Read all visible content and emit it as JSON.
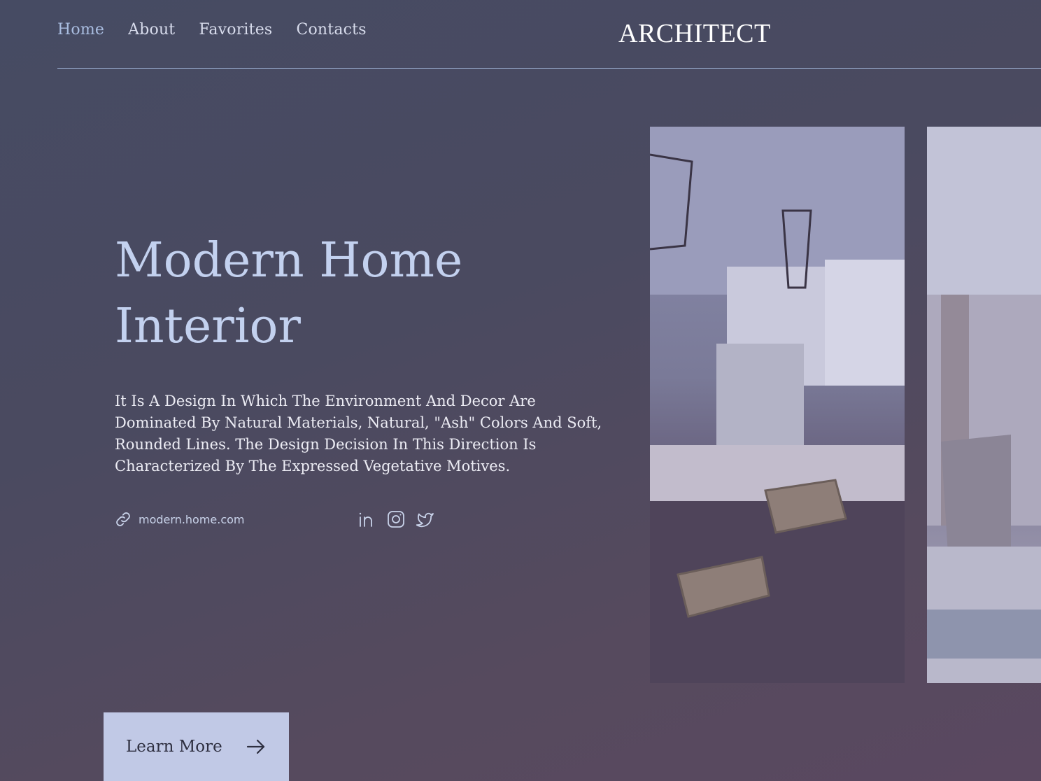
{
  "nav": {
    "items": [
      {
        "label": "Home",
        "active": true
      },
      {
        "label": "About",
        "active": false
      },
      {
        "label": "Favorites",
        "active": false
      },
      {
        "label": "Contacts",
        "active": false
      }
    ],
    "brand": "ARCHITECT"
  },
  "hero": {
    "title_line1": "Modern Home",
    "title_line2": "Interior",
    "description": "It Is A Design In Which The Environment And Decor Are Dominated By Natural Materials, Natural, \"Ash\" Colors And Soft, Rounded Lines. The Design Decision In This Direction Is Characterized By The Expressed Vegetative Motives.",
    "link_text": "modern.home.com",
    "link_icon": "link-icon",
    "social_icons": [
      "linkedin-icon",
      "instagram-icon",
      "twitter-icon"
    ],
    "cta_label": "Learn More",
    "cta_icon": "arrow-right-icon"
  },
  "gallery": {
    "images": [
      "kitchen-photo",
      "living-room-photo"
    ]
  },
  "colors": {
    "accent": "#a9bde0",
    "button_bg": "#c1c9e6",
    "title": "#c3d1ef"
  }
}
